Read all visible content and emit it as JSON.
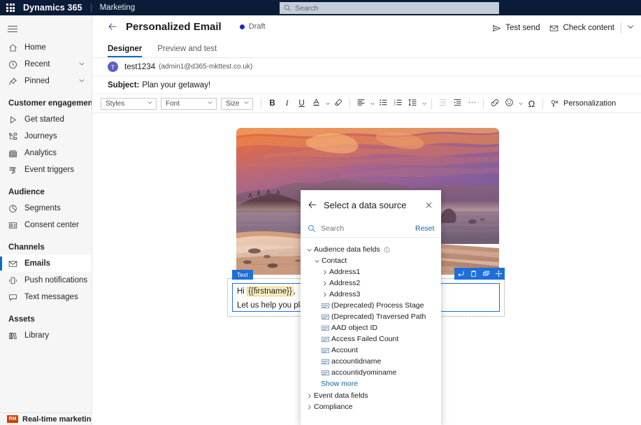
{
  "suite": {
    "waffle_icon": "waffle-grid-icon",
    "brand": "Dynamics 365",
    "app": "Marketing",
    "search_placeholder": "Search",
    "search_icon": "search-icon"
  },
  "sidebar": {
    "hamburger_icon": "hamburger-menu-icon",
    "top_items": [
      {
        "label": "Home",
        "icon": "home-icon",
        "expandable": false
      },
      {
        "label": "Recent",
        "icon": "clock-icon",
        "expandable": true
      },
      {
        "label": "Pinned",
        "icon": "pin-icon",
        "expandable": true
      }
    ],
    "groups": [
      {
        "title": "Customer engagement",
        "items": [
          {
            "label": "Get started",
            "icon": "play-triangle-icon"
          },
          {
            "label": "Journeys",
            "icon": "journeys-icon"
          },
          {
            "label": "Analytics",
            "icon": "analytics-icon"
          },
          {
            "label": "Event triggers",
            "icon": "event-trigger-icon"
          }
        ]
      },
      {
        "title": "Audience",
        "items": [
          {
            "label": "Segments",
            "icon": "segments-icon"
          },
          {
            "label": "Consent center",
            "icon": "consent-center-icon"
          }
        ]
      },
      {
        "title": "Channels",
        "items": [
          {
            "label": "Emails",
            "icon": "envelope-icon",
            "selected": true
          },
          {
            "label": "Push notifications",
            "icon": "mobile-icon"
          },
          {
            "label": "Text messages",
            "icon": "chat-bubble-icon"
          }
        ]
      },
      {
        "title": "Assets",
        "items": [
          {
            "label": "Library",
            "icon": "library-icon"
          }
        ]
      }
    ],
    "bottom": {
      "badge": "RM",
      "label": "Real-time marketing"
    }
  },
  "header": {
    "back_icon": "back-arrow-icon",
    "title": "Personalized Email",
    "status": "Draft",
    "status_color": "#1f22d6",
    "actions": [
      {
        "label": "Test send",
        "icon": "send-icon"
      },
      {
        "label": "Check content",
        "icon": "envelope-icon"
      }
    ],
    "overflow_icon": "chevron-down-icon"
  },
  "tabs": [
    {
      "label": "Designer",
      "active": true
    },
    {
      "label": "Preview and test",
      "active": false
    }
  ],
  "email": {
    "avatar_initial": "T",
    "sender_name": "test1234",
    "sender_email": "(admin1@d365-mkttest.co.uk)",
    "subject_label": "Subject:",
    "subject_value": "Plan your getaway!"
  },
  "format_toolbar": {
    "selects": [
      {
        "name": "styles",
        "label": "Styles"
      },
      {
        "name": "font",
        "label": "Font"
      },
      {
        "name": "size",
        "label": "Size"
      }
    ],
    "bold": "B",
    "italic": "I",
    "underline": "U",
    "font_color_icon": "font-color-icon",
    "highlight_icon": "highlighter-icon",
    "align_icon": "align-left-icon",
    "bullet_list_icon": "bulleted-list-icon",
    "numbered_list_icon": "numbered-list-icon",
    "line_spacing_icon": "line-spacing-icon",
    "outdent_icon": "outdent-icon",
    "indent_icon": "indent-icon",
    "more_icon": "more-horizontal-icon",
    "link_icon": "link-icon",
    "emoji_icon": "emoji-icon",
    "symbol_icon": "Ω",
    "personalization_icon": "personalization-icon",
    "personalization_label": "Personalization"
  },
  "canvas": {
    "hero_image_alt": "sunset-beach-photo",
    "text_block": {
      "tag": "Text",
      "line1_prefix": "Hi ",
      "line1_token": "{{firstname}}",
      "line1_suffix": ",",
      "line2": "Let us help you plan",
      "toolbar_icons": [
        "undo-icon",
        "delete-icon",
        "duplicate-icon",
        "move-icon"
      ]
    }
  },
  "dialog": {
    "back_icon": "back-arrow-icon",
    "title": "Select a data source",
    "close_icon": "close-icon",
    "search_icon": "search-icon",
    "search_placeholder": "Search",
    "reset_label": "Reset",
    "tree": {
      "audience": {
        "label": "Audience data fields",
        "expanded": true,
        "info_icon": "info-icon",
        "contact": {
          "label": "Contact",
          "expanded": true,
          "groups": [
            {
              "label": "Address1",
              "expandable": true
            },
            {
              "label": "Address2",
              "expandable": true
            },
            {
              "label": "Address3",
              "expandable": true
            }
          ],
          "fields": [
            "(Deprecated) Process Stage",
            "(Deprecated) Traversed Path",
            "AAD object ID",
            "Access Failed Count",
            "Account",
            "accountidname",
            "accountidyominame"
          ],
          "show_more": "Show more"
        }
      },
      "event_data_fields": {
        "label": "Event data fields",
        "expanded": false
      },
      "compliance": {
        "label": "Compliance",
        "expanded": false
      }
    }
  }
}
